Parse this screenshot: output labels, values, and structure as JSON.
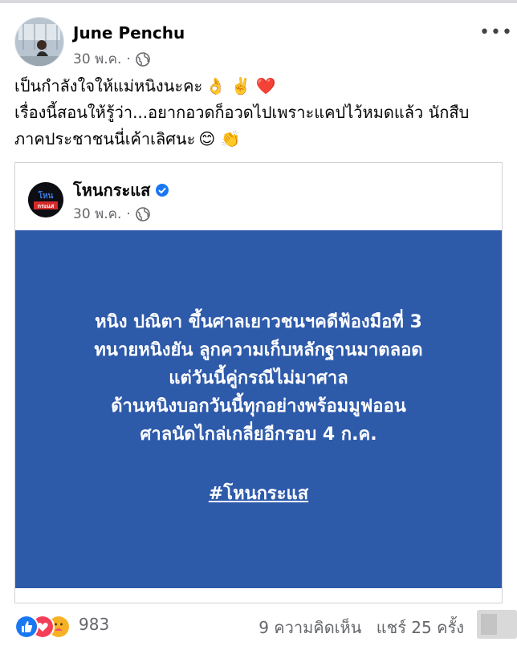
{
  "post": {
    "author": "June Penchu",
    "date": "30 พ.ค.",
    "separator": "·",
    "caption_lines": [
      "เป็นกำลังใจให้แม่หนิงนะคะ",
      "เรื่องนี้สอนให้รู้ว่า...อยากอวดก็อวดไปเพราะแคปไว้หมดแล้ว นักสืบ",
      "ภาคประชาชนนี่เค้าเลิศนะ"
    ],
    "caption_emoji": {
      "line1": "👌 ✌️ ❤️",
      "line3": "😊 👏"
    },
    "more_label": "•••"
  },
  "shared": {
    "page_name": "โหนกระแส",
    "date": "30 พ.ค.",
    "separator": "·",
    "logo_text": "โหน กระแส",
    "headline": [
      "หนิง ปณิตา ขึ้นศาลเยาวชนฯคดีฟ้องมือที่ 3",
      "ทนายหนิงยัน ลูกความเก็บหลักฐานมาตลอด",
      "แต่วันนี้คู่กรณีไม่มาศาล",
      "ด้านหนิงบอกวันนี้ทุกอย่างพร้อมมูฟออน",
      "ศาลนัดไกล่เกลี่ยอีกรอบ 4 ก.ค."
    ],
    "hash": "#",
    "hashtag": "โหนกระแส",
    "panel_color": "#2e5aaa"
  },
  "footer": {
    "reaction_count": "983",
    "comments": "9 ความคิดเห็น",
    "shares": "แชร์ 25 ครั้ง",
    "reaction_icons": [
      "like-icon",
      "love-icon",
      "care-icon"
    ]
  }
}
